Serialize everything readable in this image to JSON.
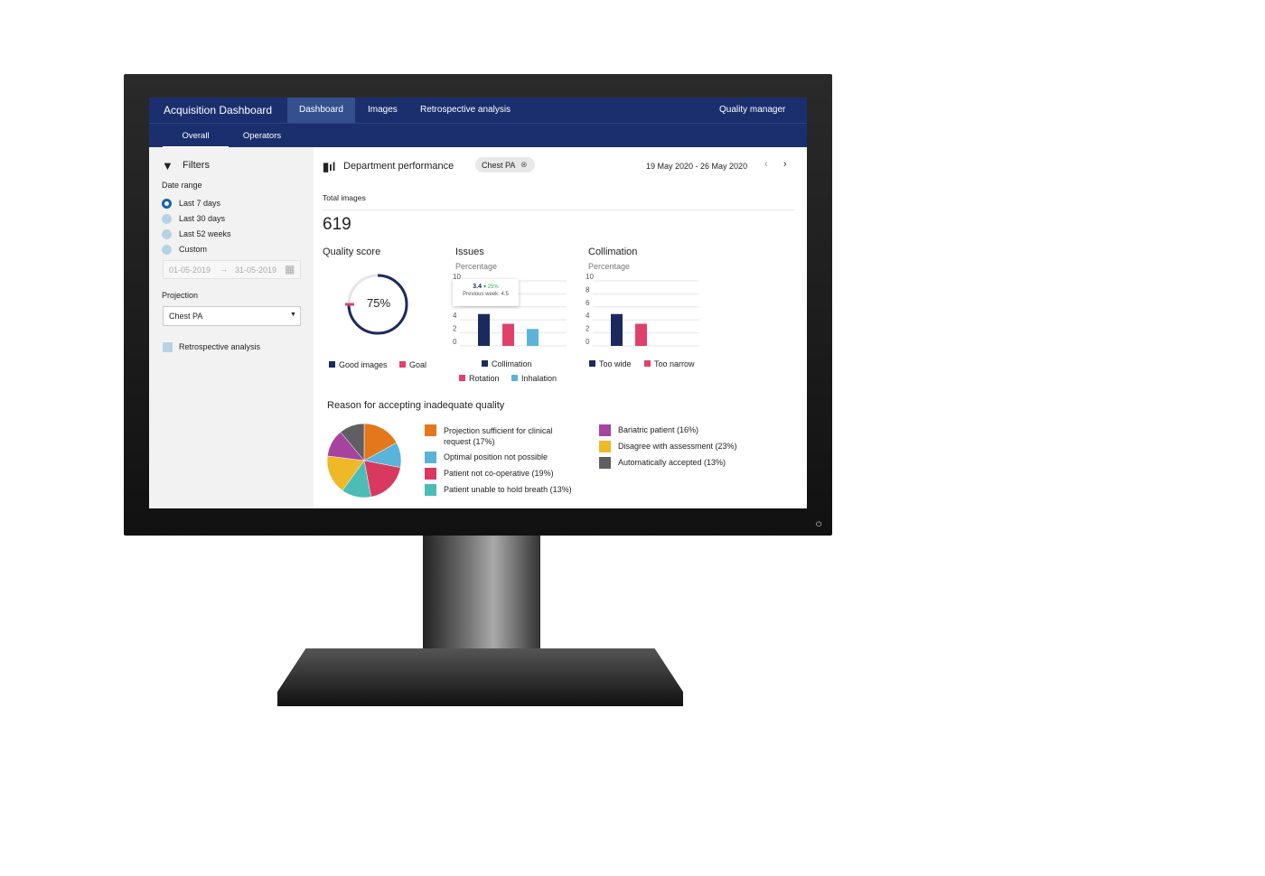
{
  "header": {
    "app_title": "Acquisition Dashboard",
    "tabs": [
      {
        "label": "Dashboard",
        "active": true
      },
      {
        "label": "Images"
      },
      {
        "label": "Retrospective analysis"
      }
    ],
    "user_menu": "Quality manager",
    "subtabs": [
      {
        "label": "Overall",
        "active": true
      },
      {
        "label": "Operators"
      }
    ]
  },
  "filters": {
    "title": "Filters",
    "date_range_label": "Date range",
    "options": [
      "Last 7 days",
      "Last 30 days",
      "Last 52 weeks",
      "Custom"
    ],
    "selected": "Last 7 days",
    "date_from": "01-05-2019",
    "date_to": "31-05-2019",
    "projection_label": "Projection",
    "projection_value": "Chest PA",
    "retro_label": "Retrospective analysis",
    "retro_checked": false
  },
  "main": {
    "title": "Department performance",
    "chip": "Chest PA",
    "date_range": "19 May 2020 - 26 May 2020",
    "total_label": "Total images",
    "total_value": "619"
  },
  "quality": {
    "title": "Quality score",
    "value_text": "75%",
    "value": 75,
    "goal": 75,
    "legend": [
      "Good images",
      "Goal"
    ]
  },
  "issues": {
    "title": "Issues",
    "subtitle": "Percentage",
    "tooltip_value": "3.4",
    "tooltip_change": "25%",
    "tooltip_prev": "Previous week: 4.5"
  },
  "collimation": {
    "title": "Collimation",
    "subtitle": "Percentage"
  },
  "pie_title": "Reason for accepting inadequate quality",
  "colors": {
    "navy": "#1b2a5e",
    "pink": "#e0416b",
    "blue": "#5ab3d9",
    "accent": "#1b2f6e"
  },
  "chart_data": [
    {
      "type": "bar",
      "title": "Issues",
      "ylabel": "Percentage",
      "ylim": [
        0,
        10
      ],
      "yticks": [
        "0",
        "2",
        "4",
        "6",
        "8",
        "10"
      ],
      "categories": [
        "Collimation",
        "Rotation",
        "Inhalation"
      ],
      "values": [
        4.9,
        3.4,
        2.6
      ],
      "colors": [
        "#1b2a5e",
        "#e0416b",
        "#5ab3d9"
      ]
    },
    {
      "type": "bar",
      "title": "Collimation",
      "ylabel": "Percentage",
      "ylim": [
        0,
        10
      ],
      "yticks": [
        "0",
        "2",
        "4",
        "6",
        "8",
        "10"
      ],
      "categories": [
        "Too wide",
        "Too narrow"
      ],
      "values": [
        4.9,
        3.4
      ],
      "colors": [
        "#1b2a5e",
        "#e0416b"
      ]
    },
    {
      "type": "pie",
      "title": "Reason for accepting inadequate quality",
      "labels": [
        "Projection sufficient for clinical request (17%)",
        "Optimal position not possible",
        "Patient not co-operative (19%)",
        "Patient unable to hold breath (13%)",
        "Disagree with assessment (23%)",
        "Bariatric patient (16%)",
        "Automatically accepted (13%)"
      ],
      "values": [
        17,
        11,
        19,
        13,
        17,
        12,
        11
      ],
      "colors": [
        "#e4761b",
        "#5ab3d9",
        "#d9395e",
        "#4cbdb5",
        "#efb827",
        "#a5449f",
        "#5f5f63"
      ]
    }
  ]
}
